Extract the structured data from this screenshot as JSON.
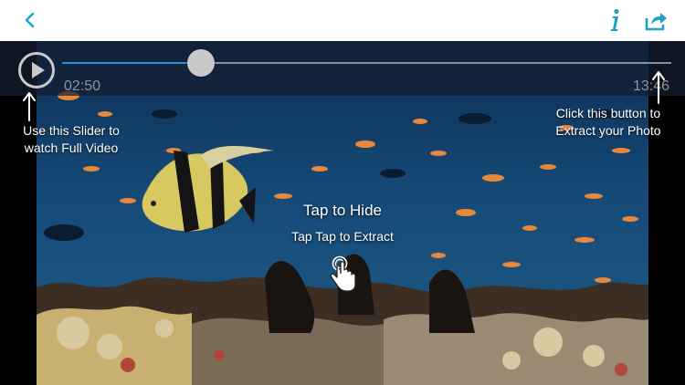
{
  "colors": {
    "accent": "#1aa3c7",
    "slider_fill": "#2a8fd6",
    "nav_background": "#ffffff"
  },
  "nav": {
    "back_icon": "chevron-left-icon",
    "info_icon": "info-icon",
    "share_icon": "share-icon"
  },
  "player": {
    "current_time": "02:50",
    "total_time": "13:46",
    "progress_fraction": 0.228,
    "play_icon": "play-icon"
  },
  "tips": {
    "slider": "Use this Slider to watch Full Video",
    "extract": "Click this button to Extract your Photo"
  },
  "overlay": {
    "tap_hide": "Tap to Hide",
    "tap_extract": "Tap Tap to Extract",
    "gesture_icon": "tap-hand-icon"
  }
}
